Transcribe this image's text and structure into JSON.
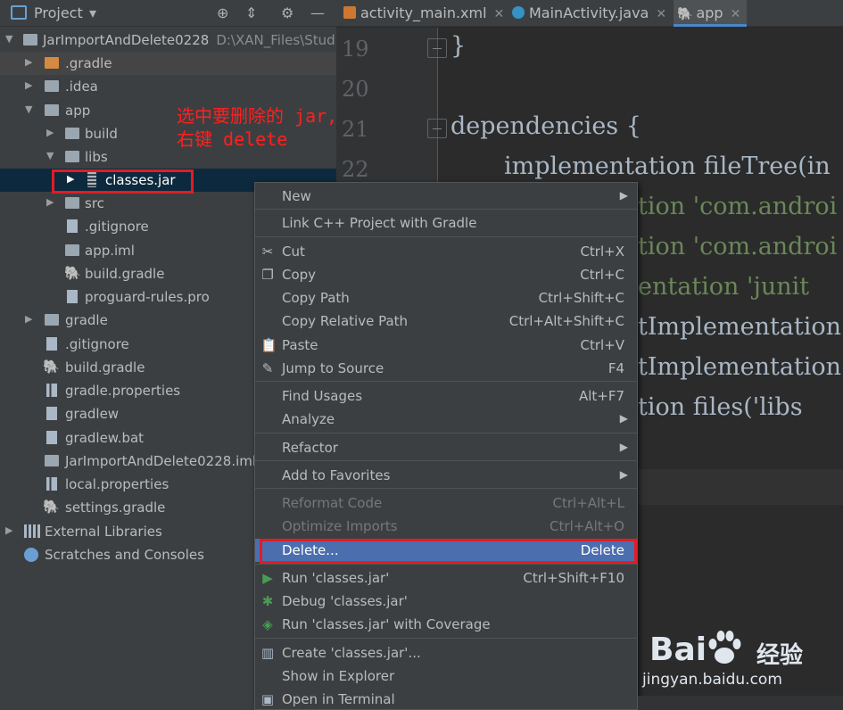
{
  "project_panel": {
    "title": "Project",
    "tree": [
      {
        "label": "JarImportAndDelete0228",
        "path": "D:\\XAN_Files\\Stud"
      },
      {
        "label": ".gradle"
      },
      {
        "label": ".idea"
      },
      {
        "label": "app"
      },
      {
        "label": "build"
      },
      {
        "label": "libs"
      },
      {
        "label": "classes.jar"
      },
      {
        "label": "src"
      },
      {
        "label": ".gitignore"
      },
      {
        "label": "app.iml"
      },
      {
        "label": "build.gradle"
      },
      {
        "label": "proguard-rules.pro"
      },
      {
        "label": "gradle"
      },
      {
        "label": ".gitignore"
      },
      {
        "label": "build.gradle"
      },
      {
        "label": "gradle.properties"
      },
      {
        "label": "gradlew"
      },
      {
        "label": "gradlew.bat"
      },
      {
        "label": "JarImportAndDelete0228.iml"
      },
      {
        "label": "local.properties"
      },
      {
        "label": "settings.gradle"
      },
      {
        "label": "External Libraries"
      },
      {
        "label": "Scratches and Consoles"
      }
    ]
  },
  "tabs": [
    {
      "label": "activity_main.xml"
    },
    {
      "label": "MainActivity.java"
    },
    {
      "label": "app"
    }
  ],
  "editor": {
    "line_numbers": [
      "19",
      "20",
      "21",
      "22"
    ],
    "lines": [
      "}",
      "dependencies {",
      "implementation fileTree(in",
      "tion 'com.androi",
      "tion 'com.androi",
      "entation 'junit",
      "tImplementation",
      "tImplementation",
      "tion files('libs"
    ]
  },
  "annotation": "选中要删除的 jar,\n右键 delete",
  "context_menu": {
    "items": [
      {
        "label": "New",
        "shortcut": ""
      },
      {
        "label": "Link C++ Project with Gradle",
        "shortcut": ""
      },
      {
        "label": "Cut",
        "shortcut": "Ctrl+X"
      },
      {
        "label": "Copy",
        "shortcut": "Ctrl+C"
      },
      {
        "label": "Copy Path",
        "shortcut": "Ctrl+Shift+C"
      },
      {
        "label": "Copy Relative Path",
        "shortcut": "Ctrl+Alt+Shift+C"
      },
      {
        "label": "Paste",
        "shortcut": "Ctrl+V"
      },
      {
        "label": "Jump to Source",
        "shortcut": "F4"
      },
      {
        "label": "Find Usages",
        "shortcut": "Alt+F7"
      },
      {
        "label": "Analyze",
        "shortcut": ""
      },
      {
        "label": "Refactor",
        "shortcut": ""
      },
      {
        "label": "Add to Favorites",
        "shortcut": ""
      },
      {
        "label": "Reformat Code",
        "shortcut": "Ctrl+Alt+L"
      },
      {
        "label": "Optimize Imports",
        "shortcut": "Ctrl+Alt+O"
      },
      {
        "label": "Delete...",
        "shortcut": "Delete"
      },
      {
        "label": "Run 'classes.jar'",
        "shortcut": "Ctrl+Shift+F10"
      },
      {
        "label": "Debug 'classes.jar'",
        "shortcut": ""
      },
      {
        "label": "Run 'classes.jar' with Coverage",
        "shortcut": ""
      },
      {
        "label": "Create 'classes.jar'...",
        "shortcut": ""
      },
      {
        "label": "Show in Explorer",
        "shortcut": ""
      },
      {
        "label": "Open in Terminal",
        "shortcut": ""
      }
    ]
  },
  "watermark": {
    "brand": "Bai",
    "brand2": "经验",
    "url": "jingyan.baidu.com"
  },
  "colors": {
    "panel_bg": "#3c3f41",
    "editor_bg": "#2b2b2b",
    "selection": "#4b6eaf",
    "annotation_red": "#e41b23",
    "string_green": "#6a8759"
  }
}
